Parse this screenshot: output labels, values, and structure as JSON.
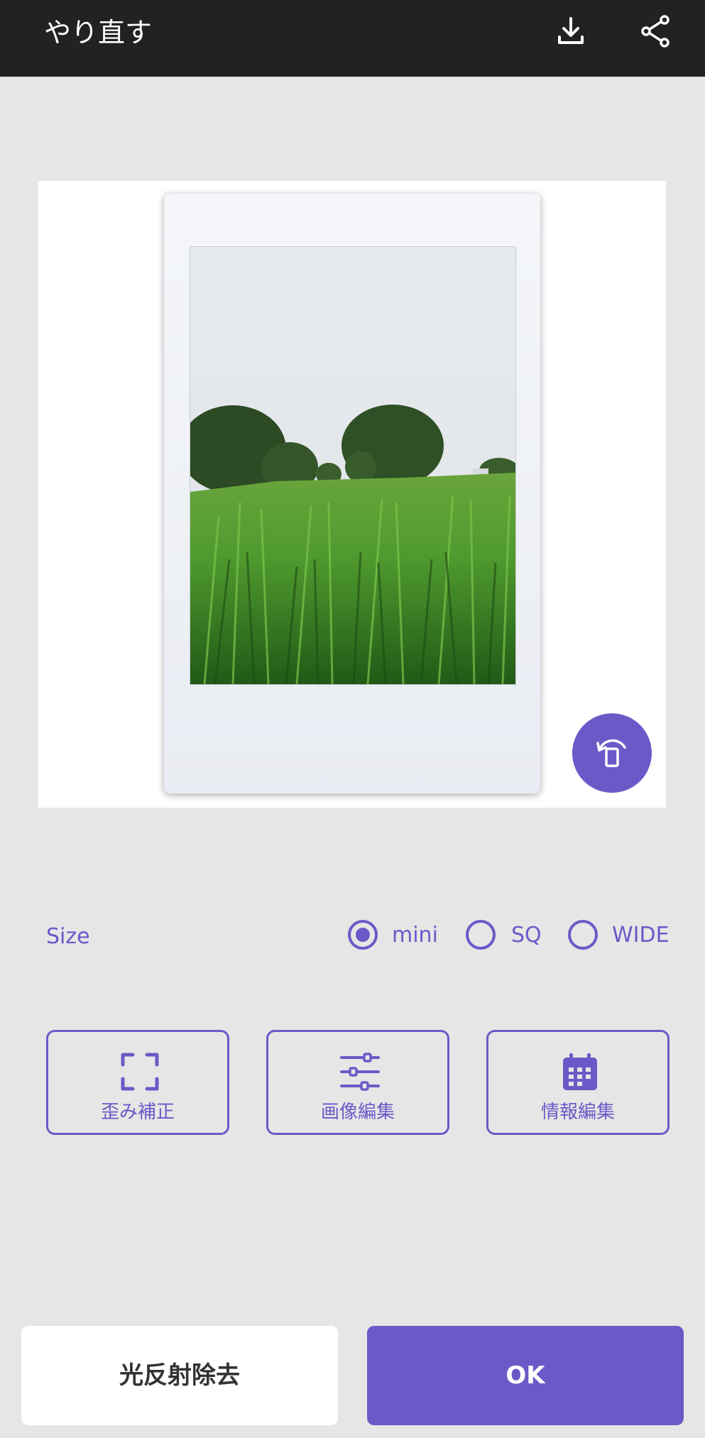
{
  "header": {
    "title": "やり直す",
    "download_icon": "download-icon",
    "share_icon": "share-icon"
  },
  "preview": {
    "rotate_icon": "rotate-icon"
  },
  "size": {
    "label": "Size",
    "options": [
      {
        "label": "mini",
        "selected": true
      },
      {
        "label": "SQ",
        "selected": false
      },
      {
        "label": "WIDE",
        "selected": false
      }
    ]
  },
  "tools": [
    {
      "label": "歪み補正",
      "icon": "crop-frame-icon"
    },
    {
      "label": "画像編集",
      "icon": "sliders-icon"
    },
    {
      "label": "情報編集",
      "icon": "calendar-icon"
    }
  ],
  "footer": {
    "remove_glare_label": "光反射除去",
    "ok_label": "OK"
  },
  "colors": {
    "accent": "#6a5ac8",
    "topbar": "#222222",
    "background": "#e6e6e6"
  }
}
